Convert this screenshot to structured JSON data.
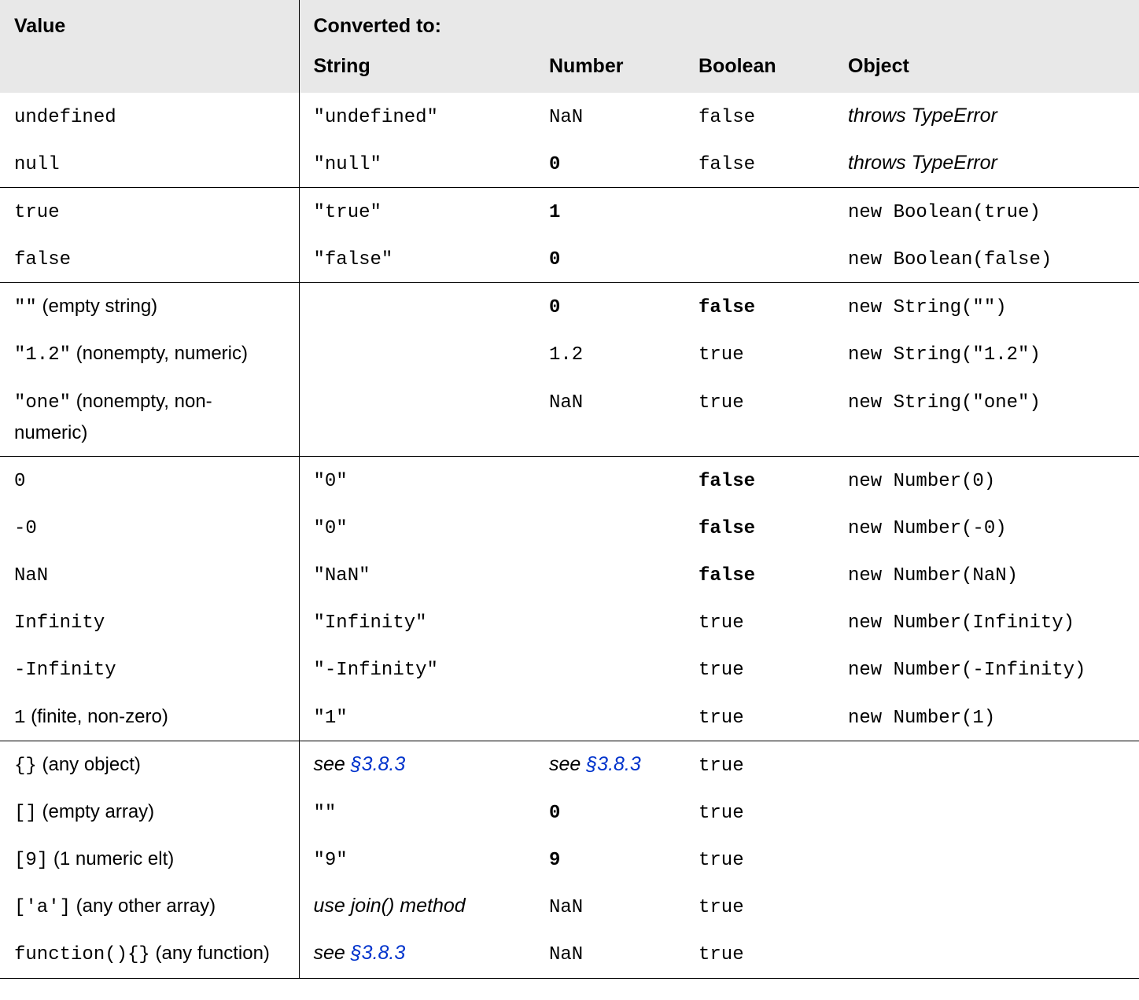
{
  "headers": {
    "value": "Value",
    "converted": "Converted to:",
    "string": "String",
    "number": "Number",
    "boolean": "Boolean",
    "object": "Object"
  },
  "rows": [
    {
      "value": [
        {
          "t": "undefined",
          "s": "mono"
        }
      ],
      "string": [
        {
          "t": "\"undefined\"",
          "s": "mono"
        }
      ],
      "number": [
        {
          "t": "NaN",
          "s": "mono"
        }
      ],
      "boolean": [
        {
          "t": "false",
          "s": "mono"
        }
      ],
      "object": [
        {
          "t": "throws TypeError",
          "s": "sans ital"
        }
      ]
    },
    {
      "value": [
        {
          "t": "null",
          "s": "mono"
        }
      ],
      "string": [
        {
          "t": "\"null\"",
          "s": "mono"
        }
      ],
      "number": [
        {
          "t": "0",
          "s": "mono bold"
        }
      ],
      "boolean": [
        {
          "t": "false",
          "s": "mono"
        }
      ],
      "object": [
        {
          "t": "throws TypeError",
          "s": "sans ital"
        }
      ],
      "groupEnd": true
    },
    {
      "value": [
        {
          "t": "true",
          "s": "mono"
        }
      ],
      "string": [
        {
          "t": "\"true\"",
          "s": "mono"
        }
      ],
      "number": [
        {
          "t": "1",
          "s": "mono bold"
        }
      ],
      "boolean": [],
      "object": [
        {
          "t": "new Boolean(true)",
          "s": "mono"
        }
      ]
    },
    {
      "value": [
        {
          "t": "false",
          "s": "mono"
        }
      ],
      "string": [
        {
          "t": "\"false\"",
          "s": "mono"
        }
      ],
      "number": [
        {
          "t": "0",
          "s": "mono bold"
        }
      ],
      "boolean": [],
      "object": [
        {
          "t": "new Boolean(false)",
          "s": "mono"
        }
      ],
      "groupEnd": true
    },
    {
      "value": [
        {
          "t": "\"\"",
          "s": "mono"
        },
        {
          "t": " (empty string)",
          "s": "note"
        }
      ],
      "string": [],
      "number": [
        {
          "t": "0",
          "s": "mono bold"
        }
      ],
      "boolean": [
        {
          "t": "false",
          "s": "mono bold"
        }
      ],
      "object": [
        {
          "t": "new String(\"\")",
          "s": "mono"
        }
      ]
    },
    {
      "value": [
        {
          "t": "\"1.2\"",
          "s": "mono"
        },
        {
          "t": " (nonempty, numeric)",
          "s": "note"
        }
      ],
      "string": [],
      "number": [
        {
          "t": "1.2",
          "s": "mono"
        }
      ],
      "boolean": [
        {
          "t": "true",
          "s": "mono"
        }
      ],
      "object": [
        {
          "t": "new String(\"1.2\")",
          "s": "mono"
        }
      ]
    },
    {
      "value": [
        {
          "t": "\"one\"",
          "s": "mono"
        },
        {
          "t": " (nonempty, non-numeric)",
          "s": "note"
        }
      ],
      "string": [],
      "number": [
        {
          "t": "NaN",
          "s": "mono"
        }
      ],
      "boolean": [
        {
          "t": "true",
          "s": "mono"
        }
      ],
      "object": [
        {
          "t": "new String(\"one\")",
          "s": "mono"
        }
      ],
      "groupEnd": true
    },
    {
      "value": [
        {
          "t": "0",
          "s": "mono"
        }
      ],
      "string": [
        {
          "t": "\"0\"",
          "s": "mono"
        }
      ],
      "number": [],
      "boolean": [
        {
          "t": "false",
          "s": "mono bold"
        }
      ],
      "object": [
        {
          "t": "new Number(0)",
          "s": "mono"
        }
      ]
    },
    {
      "value": [
        {
          "t": "-0",
          "s": "mono"
        }
      ],
      "string": [
        {
          "t": "\"0\"",
          "s": "mono"
        }
      ],
      "number": [],
      "boolean": [
        {
          "t": "false",
          "s": "mono bold"
        }
      ],
      "object": [
        {
          "t": "new Number(-0)",
          "s": "mono"
        }
      ]
    },
    {
      "value": [
        {
          "t": "NaN",
          "s": "mono"
        }
      ],
      "string": [
        {
          "t": "\"NaN\"",
          "s": "mono"
        }
      ],
      "number": [],
      "boolean": [
        {
          "t": "false",
          "s": "mono bold"
        }
      ],
      "object": [
        {
          "t": "new Number(NaN)",
          "s": "mono"
        }
      ]
    },
    {
      "value": [
        {
          "t": "Infinity",
          "s": "mono"
        }
      ],
      "string": [
        {
          "t": "\"Infinity\"",
          "s": "mono"
        }
      ],
      "number": [],
      "boolean": [
        {
          "t": "true",
          "s": "mono"
        }
      ],
      "object": [
        {
          "t": "new Number(Infinity)",
          "s": "mono"
        }
      ]
    },
    {
      "value": [
        {
          "t": "-Infinity",
          "s": "mono"
        }
      ],
      "string": [
        {
          "t": "\"-Infinity\"",
          "s": "mono"
        }
      ],
      "number": [],
      "boolean": [
        {
          "t": "true",
          "s": "mono"
        }
      ],
      "object": [
        {
          "t": "new Number(-Infinity)",
          "s": "mono"
        }
      ]
    },
    {
      "value": [
        {
          "t": "1",
          "s": "mono"
        },
        {
          "t": " (finite, non-zero)",
          "s": "note"
        }
      ],
      "string": [
        {
          "t": "\"1\"",
          "s": "mono"
        }
      ],
      "number": [],
      "boolean": [
        {
          "t": "true",
          "s": "mono"
        }
      ],
      "object": [
        {
          "t": "new Number(1)",
          "s": "mono"
        }
      ],
      "groupEnd": true
    },
    {
      "value": [
        {
          "t": "{}",
          "s": "mono"
        },
        {
          "t": " (any object)",
          "s": "note"
        }
      ],
      "string": [
        {
          "t": "see ",
          "s": "sans ital"
        },
        {
          "t": "§3.8.3",
          "s": "link"
        }
      ],
      "number": [
        {
          "t": "see ",
          "s": "sans ital"
        },
        {
          "t": "§3.8.3",
          "s": "link"
        }
      ],
      "boolean": [
        {
          "t": "true",
          "s": "mono"
        }
      ],
      "object": []
    },
    {
      "value": [
        {
          "t": "[]",
          "s": "mono"
        },
        {
          "t": " (empty array)",
          "s": "note"
        }
      ],
      "string": [
        {
          "t": "\"\"",
          "s": "mono"
        }
      ],
      "number": [
        {
          "t": "0",
          "s": "mono bold"
        }
      ],
      "boolean": [
        {
          "t": "true",
          "s": "mono"
        }
      ],
      "object": []
    },
    {
      "value": [
        {
          "t": "[9]",
          "s": "mono"
        },
        {
          "t": " (1 numeric elt)",
          "s": "note"
        }
      ],
      "string": [
        {
          "t": "\"9\"",
          "s": "mono"
        }
      ],
      "number": [
        {
          "t": "9",
          "s": "mono bold"
        }
      ],
      "boolean": [
        {
          "t": "true",
          "s": "mono"
        }
      ],
      "object": []
    },
    {
      "value": [
        {
          "t": "['a']",
          "s": "mono"
        },
        {
          "t": " (any other array)",
          "s": "note"
        }
      ],
      "string": [
        {
          "t": "use join() method",
          "s": "sans ital"
        }
      ],
      "number": [
        {
          "t": "NaN",
          "s": "mono"
        }
      ],
      "boolean": [
        {
          "t": "true",
          "s": "mono"
        }
      ],
      "object": []
    },
    {
      "value": [
        {
          "t": "function(){}",
          "s": "mono"
        },
        {
          "t": " (any function)",
          "s": "note"
        }
      ],
      "string": [
        {
          "t": "see ",
          "s": "sans ital"
        },
        {
          "t": "§3.8.3",
          "s": "link"
        }
      ],
      "number": [
        {
          "t": "NaN",
          "s": "mono"
        }
      ],
      "boolean": [
        {
          "t": "true",
          "s": "mono"
        }
      ],
      "object": []
    }
  ]
}
